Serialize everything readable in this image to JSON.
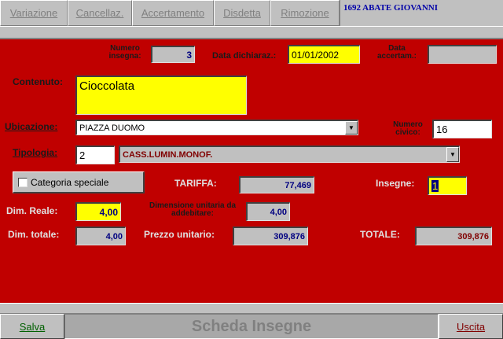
{
  "toolbar": {
    "variazione": "Variazione",
    "cancellaz": "Cancellaz.",
    "accertamento": "Accertamento",
    "disdetta": "Disdetta",
    "rimozione": "Rimozione",
    "user": "1692 ABATE GIOVANNI"
  },
  "form": {
    "numero_insegna_label": "Numero insegna:",
    "numero_insegna_value": "3",
    "data_dichiaraz_label": "Data dichiaraz.:",
    "data_dichiaraz_value": "01/01/2002",
    "data_accertam_label": "Data accertam.:",
    "data_accertam_value": "",
    "contenuto_label": "Contenuto:",
    "contenuto_value": "Cioccolata",
    "ubicazione_label": "Ubicazione:",
    "ubicazione_value": "PIAZZA DUOMO",
    "numero_civico_label": "Numero civico:",
    "numero_civico_value": "16",
    "tipologia_label": "Tipologia:",
    "tipologia_code": "2",
    "tipologia_desc": "CASS.LUMIN.MONOF.",
    "categoria_speciale_label": "Categoria speciale",
    "categoria_speciale_checked": false,
    "tariffa_label": "TARIFFA:",
    "tariffa_value": "77,469",
    "insegne_label": "Insegne:",
    "insegne_value": "1",
    "dim_reale_label": "Dim. Reale:",
    "dim_reale_value": "4,00",
    "dim_unitaria_label": "Dimensione unitaria da addebitare:",
    "dim_unitaria_value": "4,00",
    "dim_totale_label": "Dim. totale:",
    "dim_totale_value": "4,00",
    "prezzo_unitario_label": "Prezzo unitario:",
    "prezzo_unitario_value": "309,876",
    "totale_label": "TOTALE:",
    "totale_value": "309,876"
  },
  "bottom": {
    "salva": "Salva",
    "title": "Scheda Insegne",
    "uscita": "Uscita"
  },
  "colors": {
    "panel": "#c00000",
    "highlight_field": "#ffff00",
    "value_text": "#000080"
  }
}
